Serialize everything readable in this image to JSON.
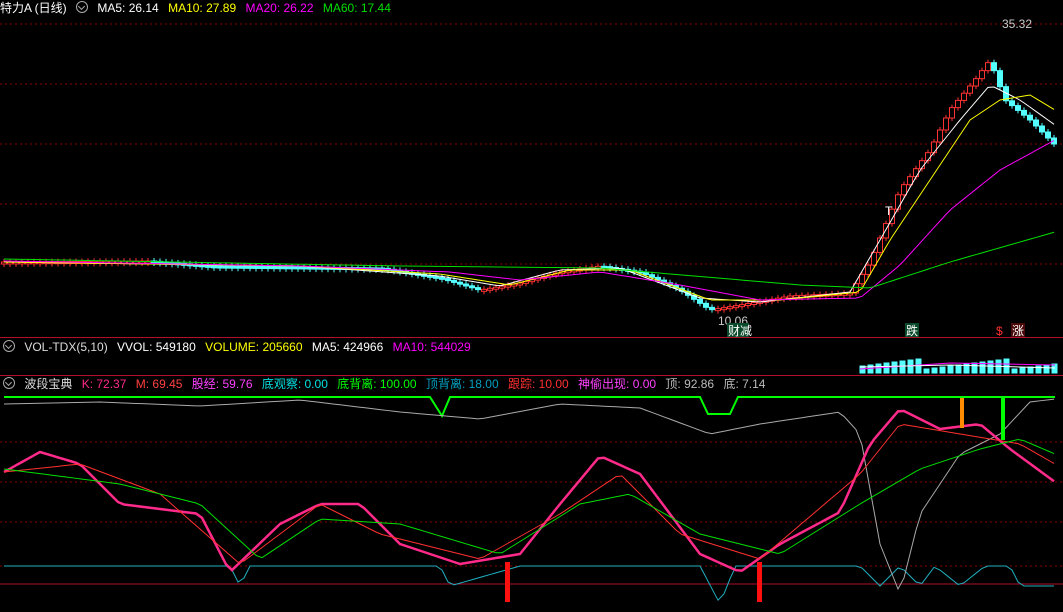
{
  "main_header": {
    "title": "特力A (日线)",
    "ma5": "MA5: 26.14",
    "ma10": "MA10: 27.89",
    "ma20": "MA20: 26.22",
    "ma60": "MA60: 17.44"
  },
  "price_labels": {
    "high": "35.32",
    "low": "10.06",
    "marker_reduce": "财减",
    "marker_fall": "跌",
    "marker_dollar": "$",
    "marker_rise": "涨",
    "marker_t": "T"
  },
  "vol_header": {
    "title": "VOL-TDX(5,10)",
    "vvol": "VVOL: 549180",
    "volume": "VOLUME: 205660",
    "ma5": "MA5: 424966",
    "ma10": "MA10: 544029"
  },
  "ind_header": {
    "title": "波段宝典",
    "k": "K: 72.37",
    "m": "M: 69.45",
    "gujing": "股经: 59.76",
    "diguan": "底观察: 0.00",
    "dibeili": "底背离: 100.00",
    "dingbeili": "顶背离: 18.00",
    "genzong": "跟踪: 10.00",
    "shentou": "神偷出现: 0.00",
    "ding": "顶: 92.86",
    "di": "底: 7.14"
  },
  "colors": {
    "up": "#ff3232",
    "down": "#54ffff",
    "ma5": "#ffffff",
    "ma10": "#ffff00",
    "ma20": "#ff00ff",
    "ma60": "#00e000",
    "k_line": "#ff2a8a",
    "grid": "#8b0000"
  },
  "icons": [
    "collapse-circle-icon"
  ]
}
